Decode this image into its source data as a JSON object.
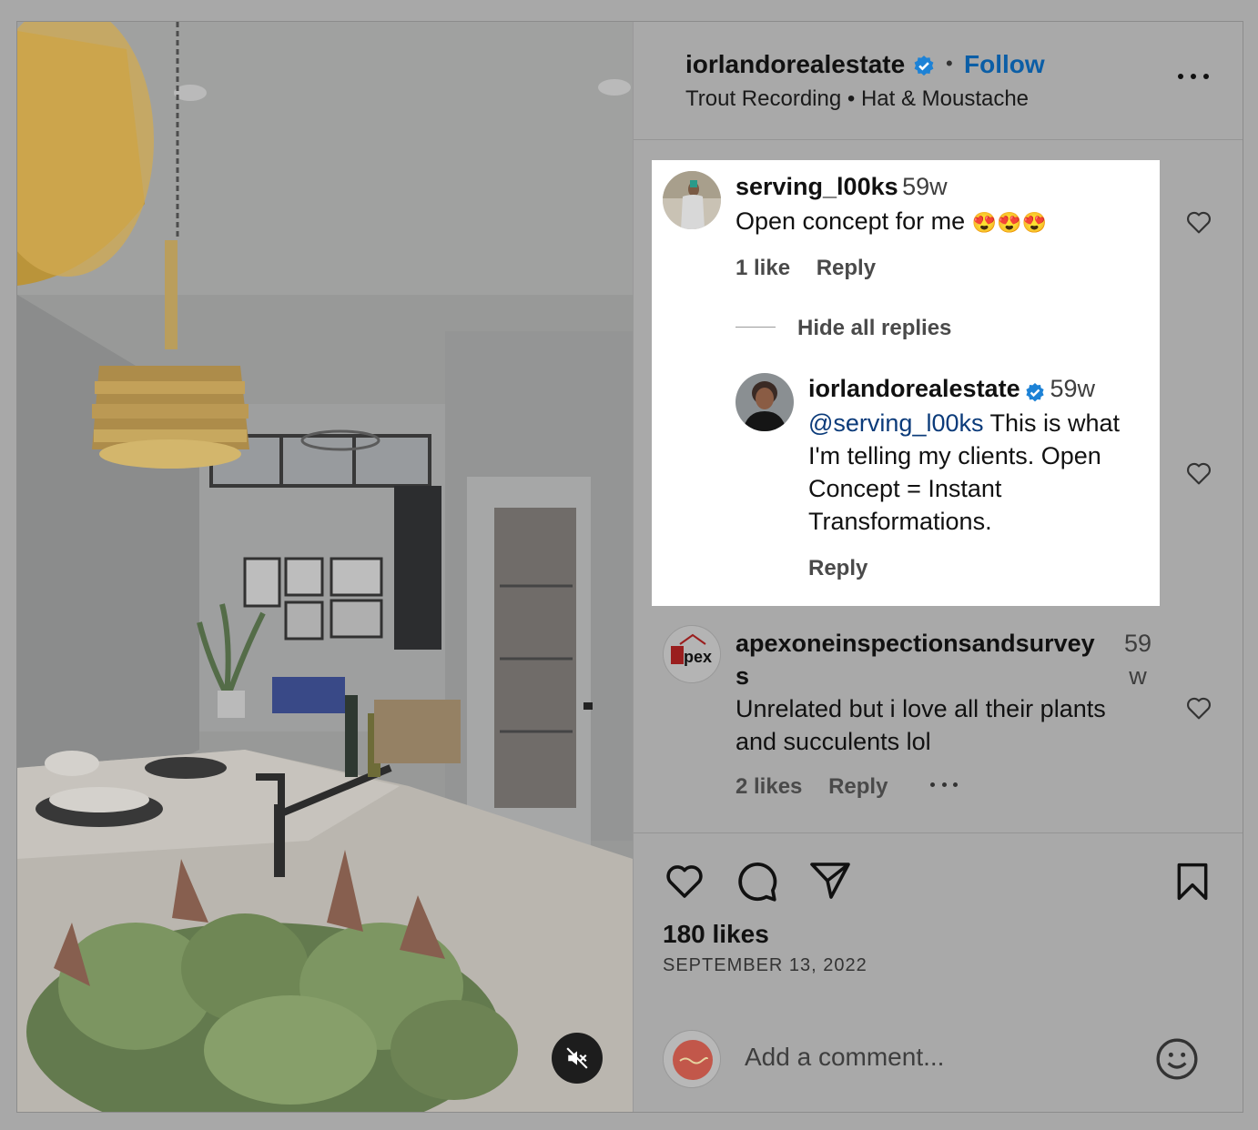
{
  "header": {
    "username": "iorlandorealestate",
    "follow_label": "Follow",
    "audio_track": "Trout Recording",
    "audio_artist": "Hat & Moustache"
  },
  "comments": [
    {
      "username": "serving_l00ks",
      "time": "59w",
      "text": "Open concept for me",
      "emoji": "😍😍😍",
      "likes": "1 like",
      "reply_label": "Reply",
      "hide_replies_label": "Hide all replies",
      "replies": [
        {
          "username": "iorlandorealestate",
          "time": "59w",
          "mention": "@serving_l00ks",
          "text_line1": " This is what",
          "text_line2": "I'm telling my clients. Open",
          "text_line3": "Concept = Instant",
          "text_line4": "Transformations.",
          "reply_label": "Reply"
        }
      ]
    },
    {
      "username_line1": "apexoneinspectionsandsurvey",
      "username_line2": "s",
      "time_line1": "59",
      "time_line2": "w",
      "text_line1": "Unrelated but i love all their plants",
      "text_line2": "and succulents lol",
      "likes": "2 likes",
      "reply_label": "Reply"
    }
  ],
  "footer": {
    "likes": "180 likes",
    "date": "SEPTEMBER 13, 2022",
    "comment_placeholder": "Add a comment..."
  },
  "icons": {
    "verified": "verified-badge-icon",
    "more": "more-options-icon",
    "like": "heart-icon",
    "comment": "comment-icon",
    "share": "share-icon",
    "save": "bookmark-icon",
    "emoji": "emoji-icon",
    "mute": "muted-speaker-icon"
  },
  "colors": {
    "follow": "#0b5ea6",
    "verified": "#1d82d6",
    "mention": "#0b3b7a",
    "highlight_bg": "#ffffff"
  }
}
